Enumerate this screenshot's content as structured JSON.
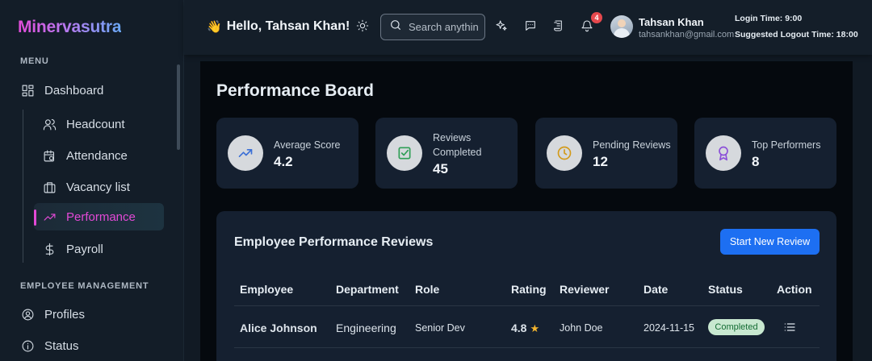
{
  "sidebar": {
    "brand": "Minervasutra",
    "menu_label": "MENU",
    "items": [
      {
        "label": "Dashboard",
        "icon": "dashboard-grid-icon"
      },
      {
        "label": "Headcount",
        "icon": "users-icon"
      },
      {
        "label": "Attendance",
        "icon": "calendar-clock-icon"
      },
      {
        "label": "Vacancy list",
        "icon": "briefcase-icon"
      },
      {
        "label": "Performance",
        "icon": "trending-up-icon",
        "active": true
      },
      {
        "label": "Payroll",
        "icon": "dollar-icon"
      }
    ],
    "section2_label": "EMPLOYEE MANAGEMENT",
    "items2": [
      {
        "label": "Profiles",
        "icon": "user-circle-icon"
      },
      {
        "label": "Status",
        "icon": "info-icon"
      }
    ]
  },
  "header": {
    "greeting": "Hello, Tahsan Khan!",
    "search_placeholder": "Search anything",
    "notification_count": "4",
    "user_name": "Tahsan Khan",
    "user_email": "tahsankhan@gmail.com",
    "login_time": "Login Time: 9:00",
    "logout_time": "Suggested Logout Time: 18:00"
  },
  "main": {
    "title": "Performance Board",
    "stats": [
      {
        "label": "Average Score",
        "value": "4.2",
        "icon": "trending-up-icon",
        "color": "#3b6fd6"
      },
      {
        "label": "Reviews Completed",
        "value": "45",
        "icon": "check-square-icon",
        "color": "#2f9e55"
      },
      {
        "label": "Pending Reviews",
        "value": "12",
        "icon": "clock-icon",
        "color": "#d39a1a"
      },
      {
        "label": "Top Performers",
        "value": "8",
        "icon": "award-icon",
        "color": "#8b4fd8"
      }
    ],
    "reviews": {
      "title": "Employee Performance Reviews",
      "button_label": "Start New Review",
      "columns": [
        "Employee",
        "Department",
        "Role",
        "Rating",
        "Reviewer",
        "Date",
        "Status",
        "Action"
      ],
      "rows": [
        {
          "employee": "Alice Johnson",
          "department": "Engineering",
          "role": "Senior Dev",
          "rating": "4.8",
          "reviewer": "John Doe",
          "date": "2024-11-15",
          "status": "Completed"
        }
      ]
    }
  }
}
